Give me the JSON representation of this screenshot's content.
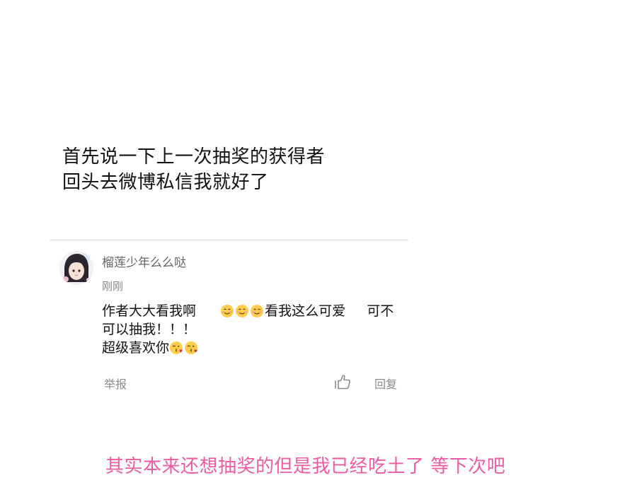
{
  "intro": {
    "line1": "首先说一下上一次抽奖的获得者",
    "line2": "回头去微博私信我就好了"
  },
  "comment": {
    "username": "榴莲少年么么哒",
    "timestamp": "刚刚",
    "body_line1_part1": "作者大大看我啊",
    "body_line1_part2": "看我这么可爱",
    "body_line1_part3": "可不",
    "body_line2": "可以抽我！！！",
    "body_line3": "超级喜欢你",
    "report_label": "举报",
    "reply_label": "回复",
    "emojis": {
      "line1": [
        "smiling-blush-emoji",
        "smiling-blush-emoji",
        "smiling-blush-emoji"
      ],
      "line3": [
        "kissing-heart-emoji",
        "kissing-heart-emoji"
      ]
    }
  },
  "footer": {
    "note": "其实本来还想抽奖的但是我已经吃土了  等下次吧"
  },
  "colors": {
    "text_primary": "#111111",
    "text_secondary": "#666666",
    "text_muted": "#8a8a8a",
    "divider": "#dedede",
    "footer_pink": "#ef5ba1"
  }
}
